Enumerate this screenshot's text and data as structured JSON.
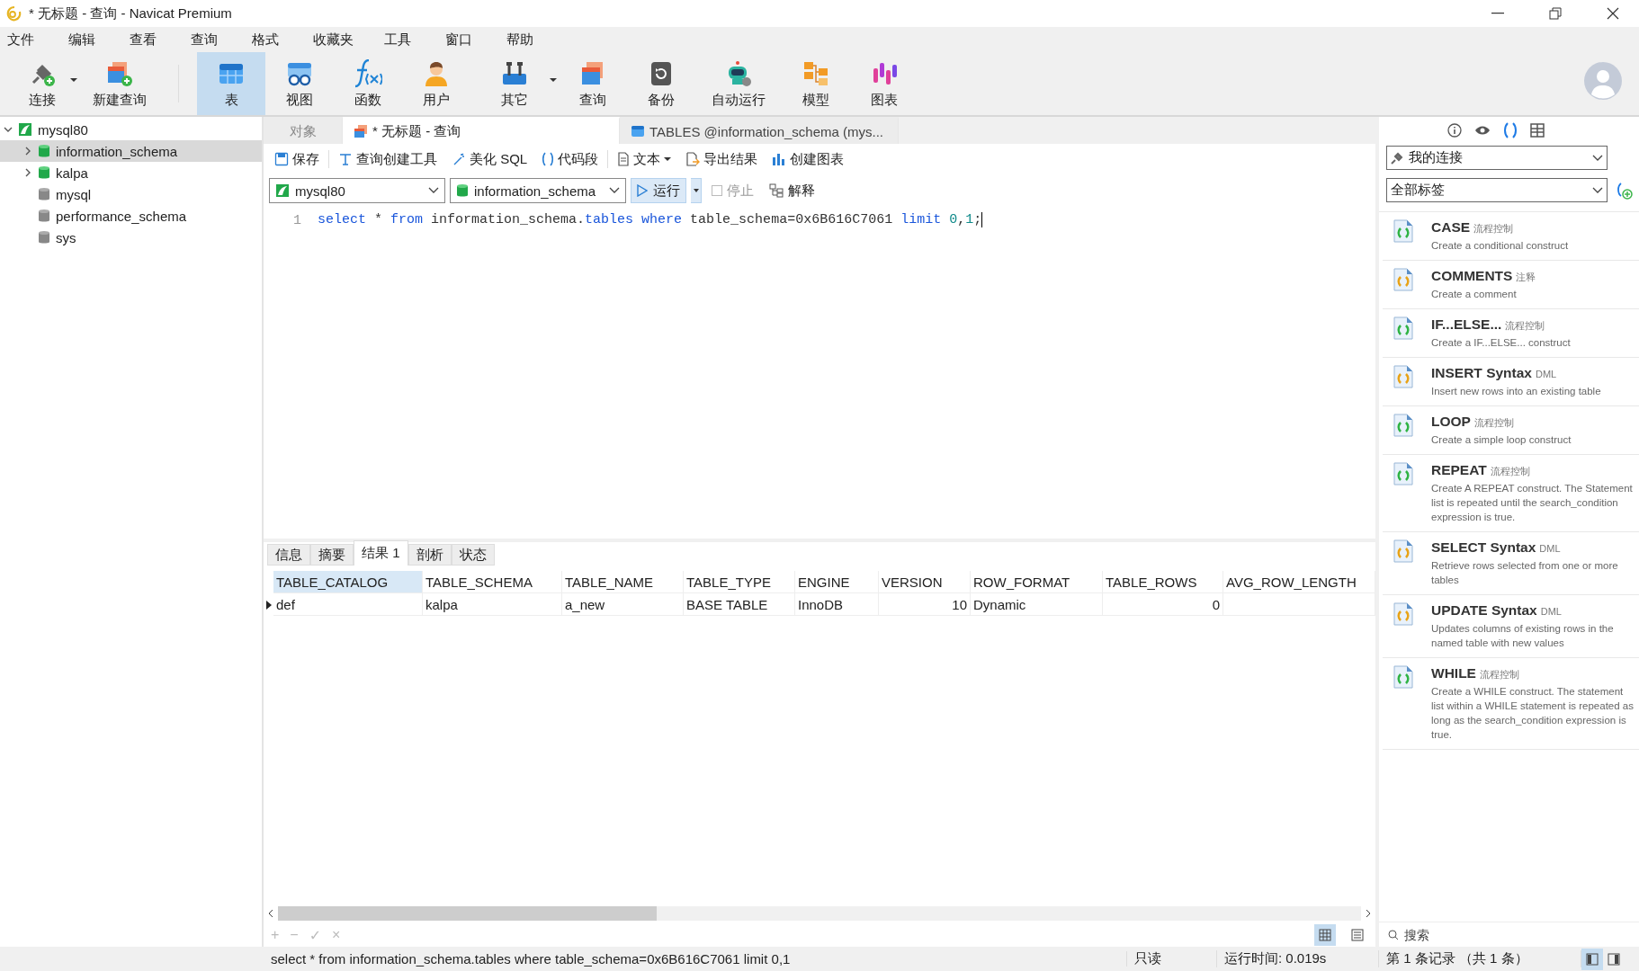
{
  "window": {
    "title": "* 无标题 - 查询 - Navicat Premium"
  },
  "menu": [
    "文件",
    "编辑",
    "查看",
    "查询",
    "格式",
    "收藏夹",
    "工具",
    "窗口",
    "帮助"
  ],
  "toolbar": [
    {
      "label": "连接",
      "selected": false,
      "dropdown": true
    },
    {
      "label": "新建查询",
      "selected": false,
      "dropdown": false
    },
    {
      "label": "表",
      "selected": true,
      "dropdown": false
    },
    {
      "label": "视图",
      "selected": false,
      "dropdown": false
    },
    {
      "label": "函数",
      "selected": false,
      "dropdown": false
    },
    {
      "label": "用户",
      "selected": false,
      "dropdown": false
    },
    {
      "label": "其它",
      "selected": false,
      "dropdown": true
    },
    {
      "label": "查询",
      "selected": false,
      "dropdown": false
    },
    {
      "label": "备份",
      "selected": false,
      "dropdown": false
    },
    {
      "label": "自动运行",
      "selected": false,
      "dropdown": false
    },
    {
      "label": "模型",
      "selected": false,
      "dropdown": false
    },
    {
      "label": "图表",
      "selected": false,
      "dropdown": false
    }
  ],
  "sidebar": {
    "tree": [
      {
        "label": "mysql80",
        "expanded": true,
        "selected": false,
        "children": [
          {
            "label": "information_schema",
            "expandable": true,
            "opened": true,
            "selected": true
          },
          {
            "label": "kalpa",
            "expandable": true,
            "opened": true,
            "selected": false
          },
          {
            "label": "mysql",
            "expandable": false,
            "opened": false,
            "selected": false
          },
          {
            "label": "performance_schema",
            "expandable": false,
            "opened": false,
            "selected": false
          },
          {
            "label": "sys",
            "expandable": false,
            "opened": false,
            "selected": false
          }
        ]
      }
    ]
  },
  "tabs": [
    {
      "label": "对象",
      "selected": false,
      "kind": "plain"
    },
    {
      "label": "* 无标题 - 查询",
      "selected": true,
      "kind": "query"
    },
    {
      "label": "TABLES @information_schema (mys...",
      "selected": false,
      "kind": "table"
    }
  ],
  "editor_toolbar": [
    {
      "label": "保存",
      "dropdown": false
    },
    {
      "label": "查询创建工具",
      "dropdown": false
    },
    {
      "label": "美化 SQL",
      "dropdown": false
    },
    {
      "label": "代码段",
      "dropdown": false
    },
    {
      "label": "文本",
      "dropdown": true
    },
    {
      "label": "导出结果",
      "dropdown": false
    },
    {
      "label": "创建图表",
      "dropdown": false
    }
  ],
  "connection_select": {
    "value": "mysql80"
  },
  "database_select": {
    "value": "information_schema"
  },
  "run_button": {
    "label": "运行"
  },
  "stop_button": {
    "label": "停止",
    "disabled": true
  },
  "explain_button": {
    "label": "解释"
  },
  "editor": {
    "lines": [
      {
        "number": "1",
        "tokens": [
          {
            "text": "select",
            "kind": "keyword"
          },
          {
            "text": " * ",
            "kind": "plain"
          },
          {
            "text": "from",
            "kind": "keyword"
          },
          {
            "text": " information_schema.",
            "kind": "plain"
          },
          {
            "text": "tables",
            "kind": "keyword"
          },
          {
            "text": " where",
            "kind": "keyword"
          },
          {
            "text": " table_schema=0x6B616C7061 ",
            "kind": "plain"
          },
          {
            "text": "limit",
            "kind": "keyword"
          },
          {
            "text": " 0",
            "kind": "number"
          },
          {
            "text": ",",
            "kind": "plain"
          },
          {
            "text": "1",
            "kind": "number"
          },
          {
            "text": ";",
            "kind": "plain"
          }
        ]
      }
    ]
  },
  "result_tabs": [
    {
      "label": "信息",
      "selected": false
    },
    {
      "label": "摘要",
      "selected": false
    },
    {
      "label": "结果 1",
      "selected": true
    },
    {
      "label": "剖析",
      "selected": false
    },
    {
      "label": "状态",
      "selected": false
    }
  ],
  "table": {
    "columns": [
      {
        "label": "TABLE_CATALOG",
        "numeric": false,
        "selected": true
      },
      {
        "label": "TABLE_SCHEMA",
        "numeric": false,
        "selected": false
      },
      {
        "label": "TABLE_NAME",
        "numeric": false,
        "selected": false
      },
      {
        "label": "TABLE_TYPE",
        "numeric": false,
        "selected": false
      },
      {
        "label": "ENGINE",
        "numeric": false,
        "selected": false
      },
      {
        "label": "VERSION",
        "numeric": true,
        "selected": false
      },
      {
        "label": "ROW_FORMAT",
        "numeric": false,
        "selected": false
      },
      {
        "label": "TABLE_ROWS",
        "numeric": true,
        "selected": false
      },
      {
        "label": "AVG_ROW_LENGTH",
        "selected": false
      }
    ],
    "rows": [
      {
        "current": true,
        "cells": [
          "def",
          "kalpa",
          "a_new",
          "BASE TABLE",
          "InnoDB",
          "10",
          "Dynamic",
          "0"
        ]
      }
    ]
  },
  "grid_actions": [
    {
      "label": "+",
      "disabled": true
    },
    {
      "label": "−",
      "disabled": true
    },
    {
      "label": "✓",
      "disabled": true
    },
    {
      "label": "×",
      "disabled": true
    }
  ],
  "view_modes": [
    {
      "selected": true
    },
    {
      "selected": false
    }
  ],
  "right_panel": {
    "tabs": [
      {
        "selected": false
      },
      {
        "selected": false
      },
      {
        "selected": true
      },
      {
        "selected": false
      }
    ],
    "connection_select": {
      "value": "我的连接"
    },
    "tag_select": {
      "value": "全部标签"
    },
    "snippets": [
      {
        "title": "CASE",
        "tag": "流程控制",
        "description": "Create a conditional construct",
        "color": "#2fb344"
      },
      {
        "title": "COMMENTS",
        "tag": "注释",
        "description": "Create a comment",
        "color": "#e8a317"
      },
      {
        "title": "IF...ELSE...",
        "tag": "流程控制",
        "description": "Create a IF...ELSE... construct",
        "color": "#2fb344"
      },
      {
        "title": "INSERT Syntax",
        "tag": "DML",
        "description": "Insert new rows into an existing table",
        "color": "#e8a317"
      },
      {
        "title": "LOOP",
        "tag": "流程控制",
        "description": "Create a simple loop construct",
        "color": "#2fb344"
      },
      {
        "title": "REPEAT",
        "tag": "流程控制",
        "description": "Create A REPEAT construct. The Statement list is repeated until the search_condition expression is true.",
        "color": "#2fb344"
      },
      {
        "title": "SELECT Syntax",
        "tag": "DML",
        "description": "Retrieve rows selected from one or more tables",
        "color": "#e8a317"
      },
      {
        "title": "UPDATE Syntax",
        "tag": "DML",
        "description": "Updates columns of existing rows in the named table with new values",
        "color": "#e8a317"
      },
      {
        "title": "WHILE",
        "tag": "流程控制",
        "description": "Create a WHILE construct. The statement list within a WHILE statement is repeated as long as the search_condition expression is true.",
        "color": "#2fb344"
      }
    ],
    "search": {
      "placeholder": "搜索"
    }
  },
  "status_bar": {
    "sql": "select * from information_schema.tables where table_schema=0x6B616C7061 limit 0,1",
    "mode": "只读",
    "time": "运行时间: 0.019s",
    "record": "第 1 条记录 （共 1 条）",
    "views": [
      {
        "selected": true
      },
      {
        "selected": false
      }
    ]
  }
}
